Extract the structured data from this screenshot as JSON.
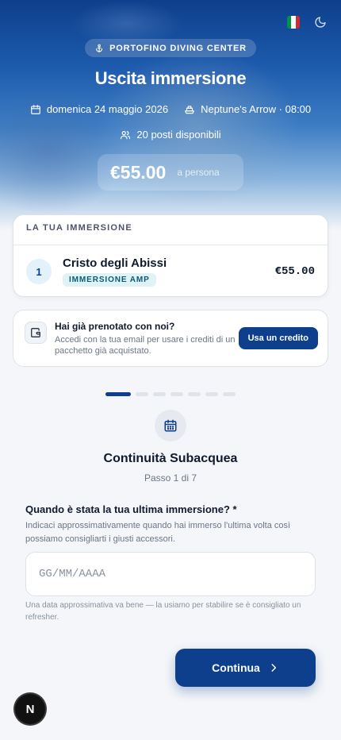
{
  "header": {
    "brand": "PORTOFINO DIVING CENTER",
    "title": "Uscita immersione",
    "date": "domenica 24 maggio 2026",
    "boat": "Neptune's Arrow · 08:00",
    "spots": "20 posti disponibili",
    "price": "€55.00",
    "price_unit": "a persona",
    "flag_colors": [
      "#009246",
      "#ffffff",
      "#ce2b37"
    ]
  },
  "summary": {
    "title": "LA TUA IMMERSIONE",
    "items": [
      {
        "index": "1",
        "name": "Cristo degli Abissi",
        "tag": "IMMERSIONE AMP",
        "price": "€55.00"
      }
    ]
  },
  "credit": {
    "title": "Hai già prenotato con noi?",
    "description": "Accedi con la tua email per usare i crediti di un pacchetto già acquistato.",
    "button": "Usa un credito"
  },
  "stepper": {
    "current": 1,
    "total": 7,
    "title": "Continuità Subacquea",
    "subtitle": "Passo 1 di 7"
  },
  "form": {
    "question": "Quando è stata la tua ultima immersione? *",
    "help": "Indicaci approssimativamente quando hai immerso l'ultima volta così possiamo consigliarti i giusti accessori.",
    "value": "",
    "placeholder": "GG/MM/AAAA",
    "note": "Una data approssimativa va bene — la usiamo per stabilire se è consigliato un refresher."
  },
  "actions": {
    "continue": "Continua"
  },
  "dev_badge": "N",
  "colors": {
    "primary": "#0d3f8c",
    "tag_bg": "#dff3f6",
    "tag_text": "#0b5a73"
  }
}
